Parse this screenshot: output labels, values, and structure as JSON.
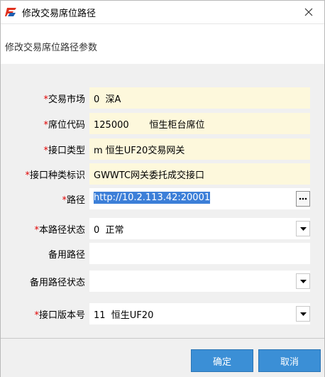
{
  "window": {
    "title": "修改交易席位路径",
    "header_text": "修改交易席位路径参数"
  },
  "colors": {
    "accent": "#3b8fd6",
    "readonly_field": "#fdf8dc",
    "required_mark": "#e00000",
    "body_bg": "#f0f0f0"
  },
  "icons": {
    "app": "app-logo-icon",
    "close": "close-icon",
    "dropdown": "chevron-down-icon",
    "browse": "ellipsis-icon"
  },
  "form": {
    "market": {
      "required_mark": "*",
      "label": "交易市场",
      "value": "0  深A"
    },
    "seat_code": {
      "required_mark": "*",
      "label": "席位代码",
      "value": "125000       恒生柜台席位"
    },
    "interface_type": {
      "required_mark": "*",
      "label": "接口类型",
      "value": "m 恒生UF20交易网关"
    },
    "interface_kind": {
      "required_mark": "*",
      "label": "接口种类标识",
      "value": "GWWTC网关委托成交接口"
    },
    "path": {
      "required_mark": "*",
      "label": "路径",
      "value": "http://10.2.113.42:20001"
    },
    "path_status": {
      "required_mark": "*",
      "label": "本路径状态",
      "value": "0  正常"
    },
    "backup_path": {
      "required_mark": "",
      "label": "备用路径",
      "value": ""
    },
    "backup_status": {
      "required_mark": "",
      "label": "备用路径状态",
      "value": ""
    },
    "version": {
      "required_mark": "*",
      "label": "接口版本号",
      "value": "11  恒生UF20"
    }
  },
  "buttons": {
    "ok": "确定",
    "cancel": "取消"
  }
}
